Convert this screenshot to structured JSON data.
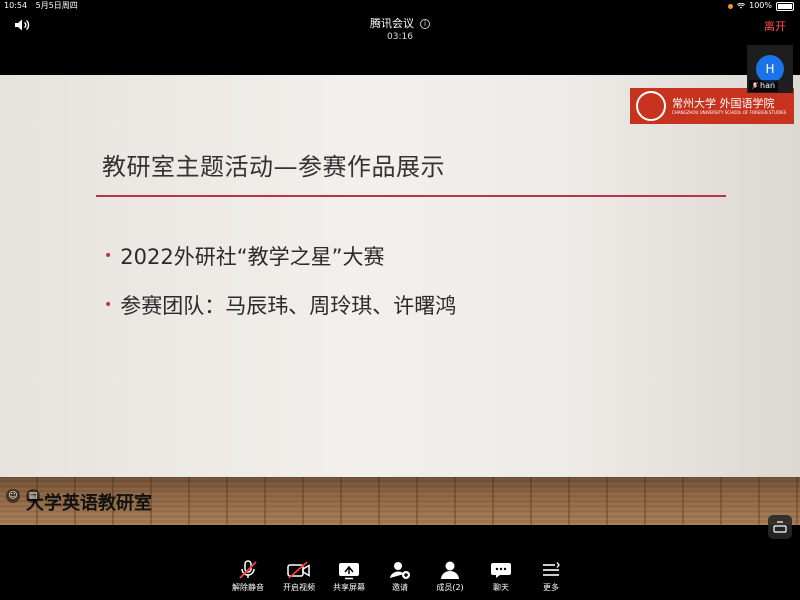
{
  "status_bar": {
    "time": "10:54",
    "date": "5月5日周四",
    "battery": "100%"
  },
  "header": {
    "title": "腾讯会议",
    "timer": "03:16",
    "leave_label": "离开"
  },
  "slide": {
    "logo": {
      "main": "常州大学  外国语学院",
      "sub": "CHANGZHOU UNIVERSITY    SCHOOL OF FOREIGN STUDIES"
    },
    "title": "教研室主题活动—参赛作品展示",
    "bullets": [
      "2022外研社“教学之星”大赛",
      "参赛团队：马辰玮、周玲琪、许曙鸿"
    ]
  },
  "watermark": "大学英语教研室",
  "participant": {
    "initial": "H",
    "name": "han"
  },
  "toolbar": {
    "items": [
      {
        "label": "解除静音",
        "icon": "mic-muted-icon"
      },
      {
        "label": "开启视频",
        "icon": "video-off-icon"
      },
      {
        "label": "共享屏幕",
        "icon": "share-screen-icon"
      },
      {
        "label": "邀请",
        "icon": "invite-icon"
      },
      {
        "label": "成员(2)",
        "icon": "members-icon"
      },
      {
        "label": "聊天",
        "icon": "chat-icon"
      },
      {
        "label": "更多",
        "icon": "more-icon"
      }
    ]
  },
  "colors": {
    "accent_red": "#c0304a",
    "leave_red": "#ff4d4f",
    "avatar_blue": "#1a73e8",
    "logo_red": "#c8331f"
  }
}
